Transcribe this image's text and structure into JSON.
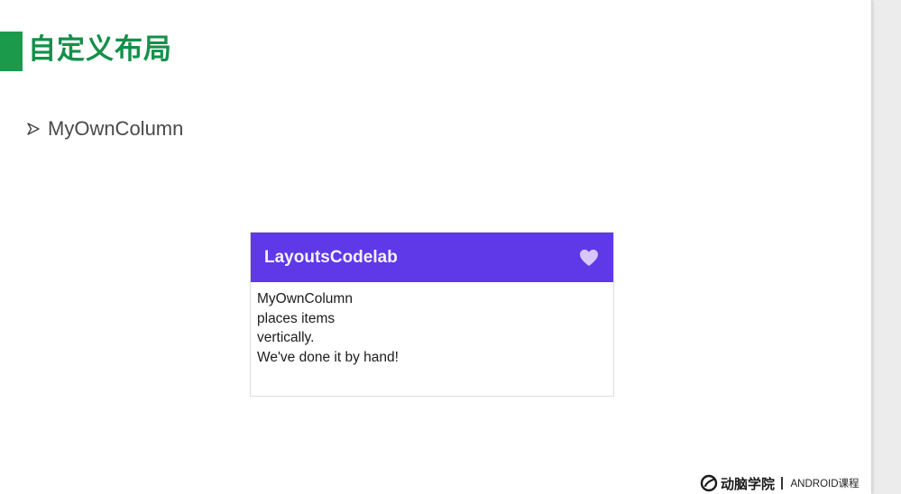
{
  "slide": {
    "title": "自定义布局",
    "bullet_text": "MyOwnColumn"
  },
  "app": {
    "title": "LayoutsCodelab",
    "app_bar_color": "#5f38e8",
    "favorite_icon": "heart-icon",
    "content_lines": [
      "MyOwnColumn",
      "places items",
      "vertically.",
      "We've done it by hand!"
    ]
  },
  "footer": {
    "brand": "动脑学院",
    "course": "ANDROID课程"
  },
  "colors": {
    "title_green": "#13904a",
    "accent_green": "#1a9a4a",
    "heart": "#d9c6ff"
  }
}
